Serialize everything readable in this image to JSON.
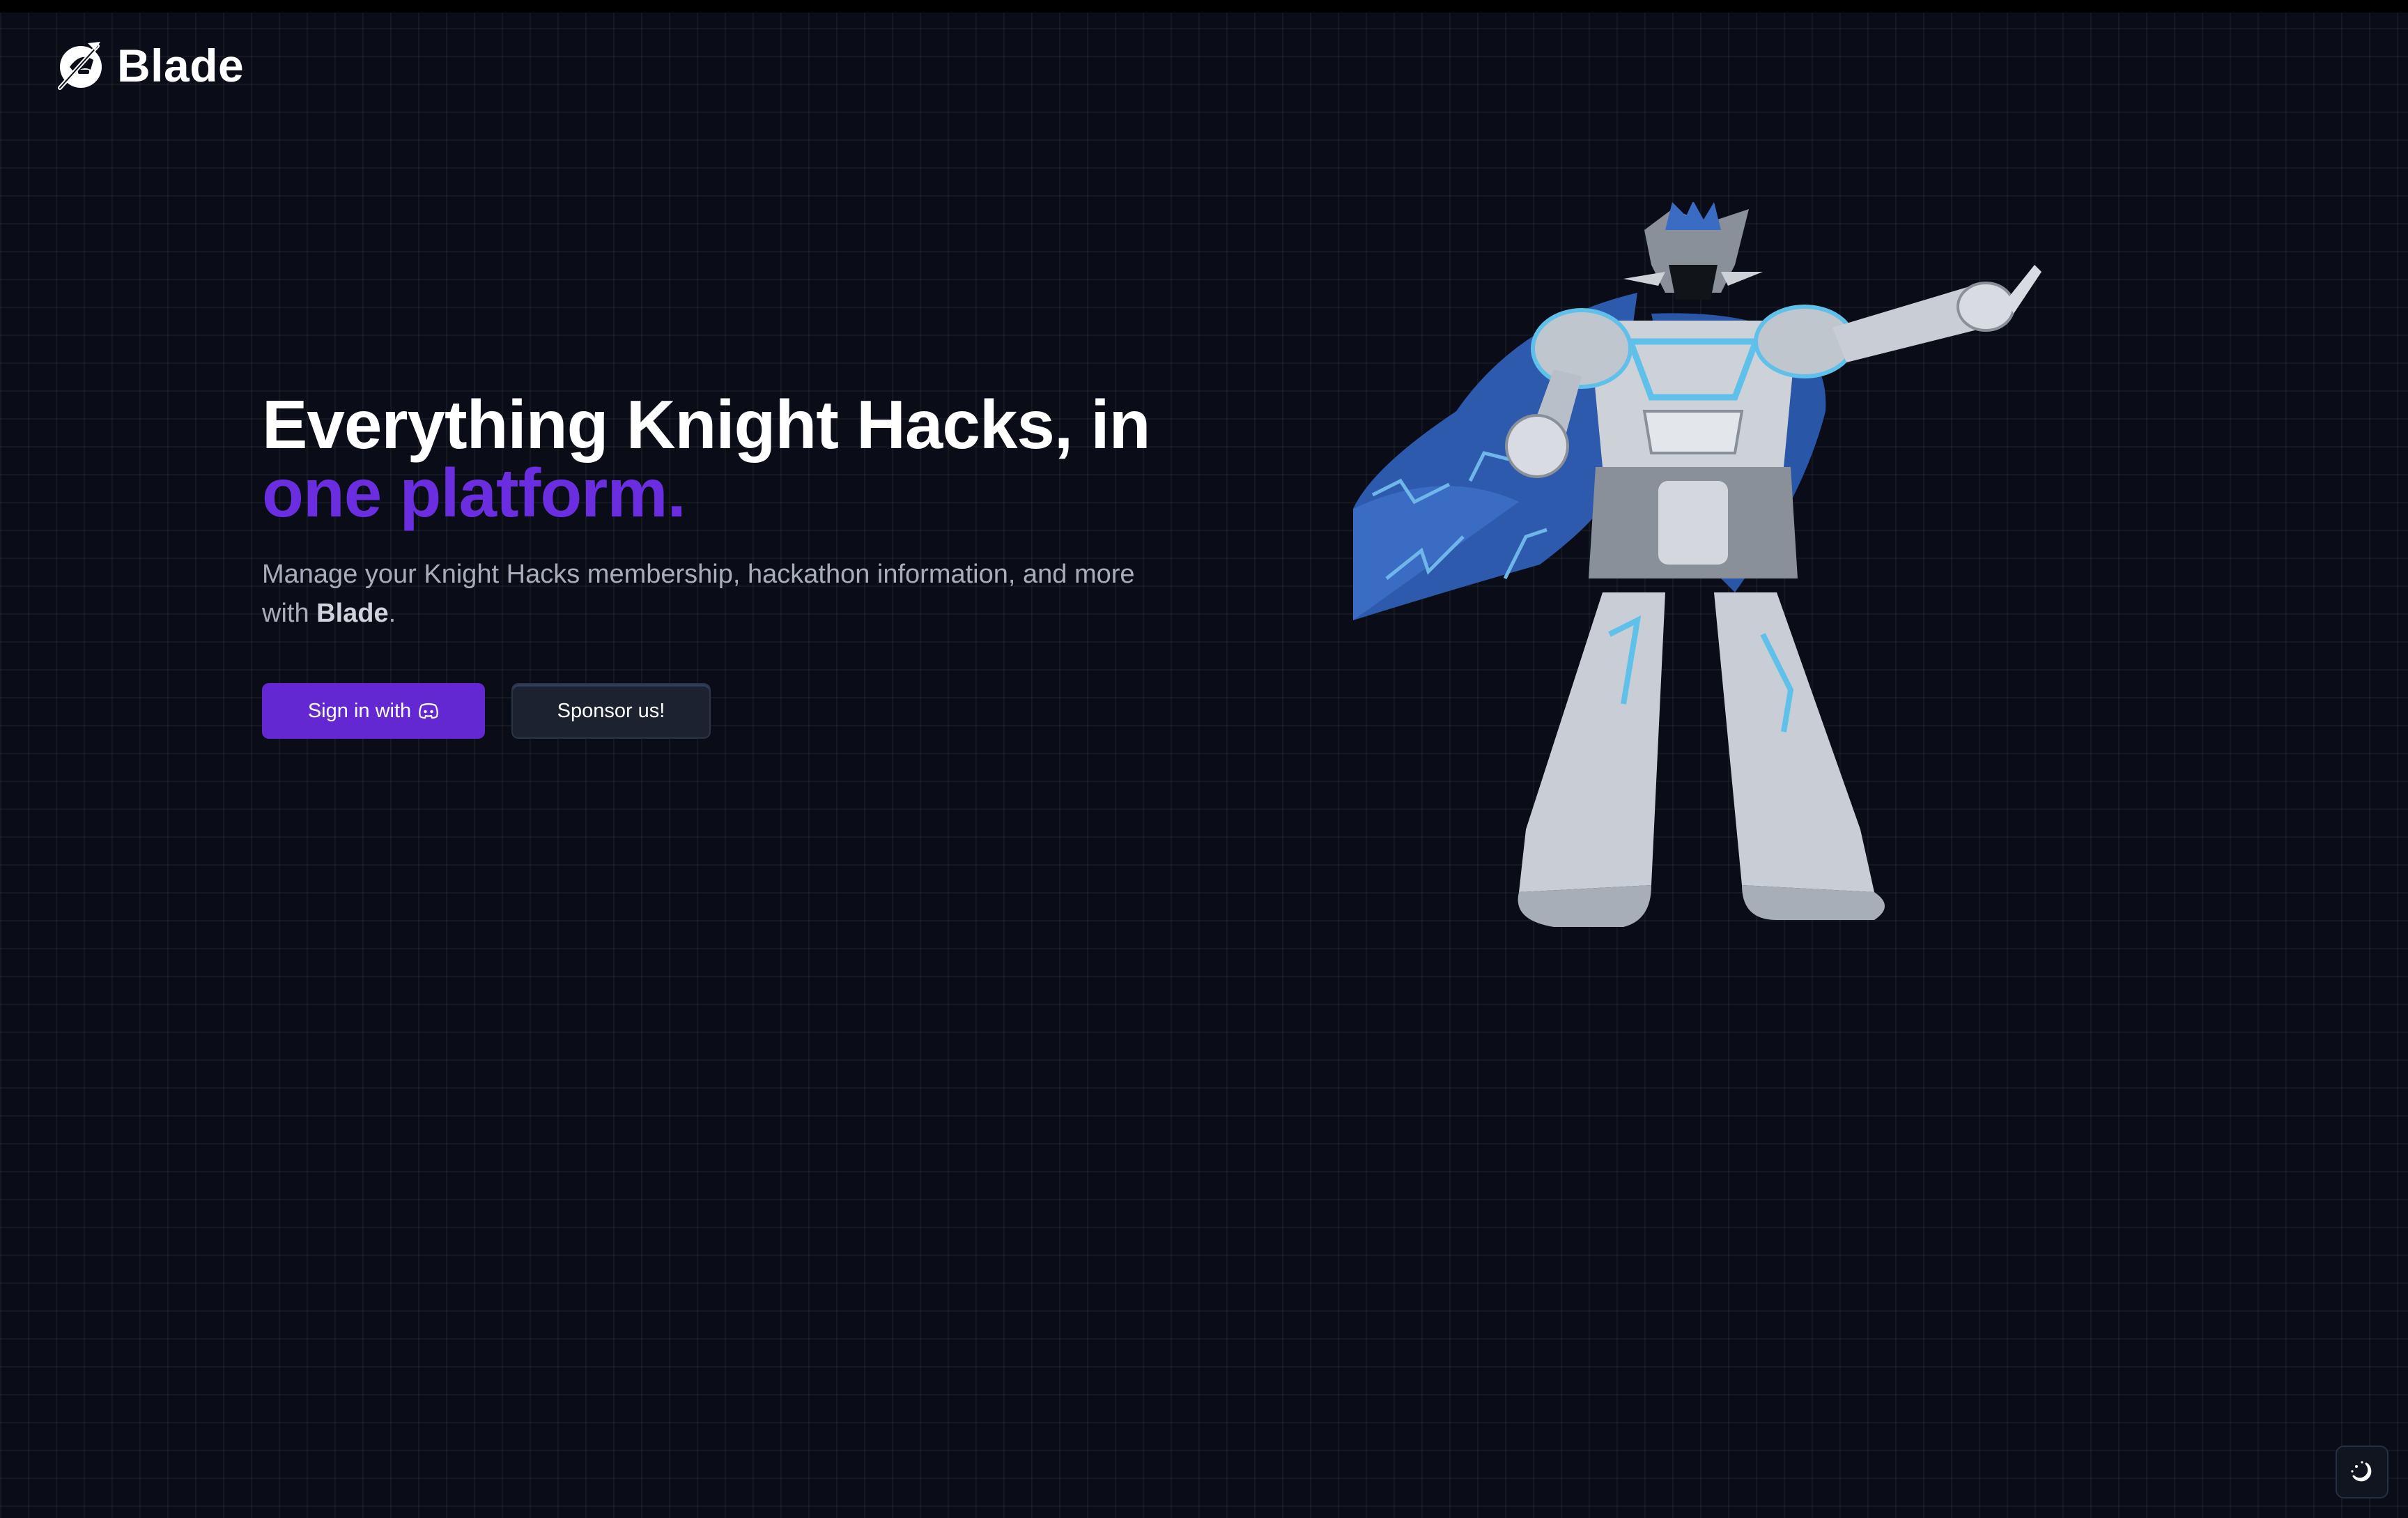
{
  "brand": {
    "name": "Blade",
    "logo_icon": "knight-helmet-logo-icon"
  },
  "hero": {
    "headline_line1": "Everything Knight Hacks, in",
    "headline_line2": "one platform.",
    "subtitle_prefix": "Manage your Knight Hacks membership, hackathon information, and more with ",
    "subtitle_brand": "Blade",
    "subtitle_suffix": ".",
    "sign_in_label": "Sign in with",
    "sign_in_icon": "discord-icon",
    "sponsor_label": "Sponsor us!"
  },
  "illustration": {
    "name": "robot-knight-illustration"
  },
  "theme_toggle": {
    "icon": "sun-moon-icon"
  },
  "colors": {
    "background": "#0a0d17",
    "accent": "#6428d2",
    "headline_accent": "#6a2ee0",
    "subtitle": "#a9adbb"
  }
}
